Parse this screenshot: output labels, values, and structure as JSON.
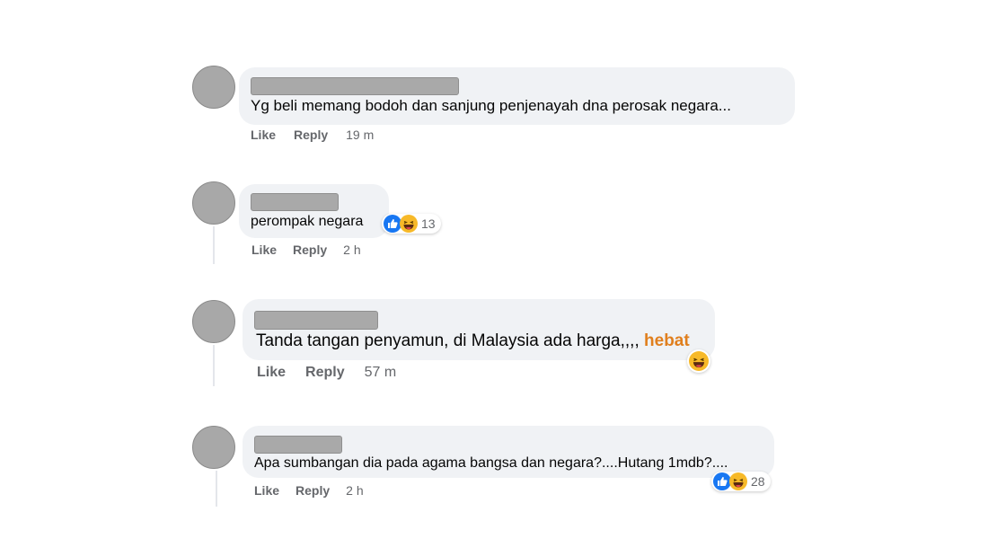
{
  "colors": {
    "bubble": "#f0f2f5",
    "muted_text": "#65676b",
    "highlight": "#e07f1e",
    "like_blue": "#1877f2",
    "haha_yellow": "#f7b928"
  },
  "comments": [
    {
      "text": "Yg beli memang bodoh dan sanjung penjenayah dna perosak negara...",
      "actions": {
        "like": "Like",
        "reply": "Reply",
        "time": "19 m"
      }
    },
    {
      "text": "perompak negara",
      "reactions": {
        "icons": [
          "like-icon",
          "haha-icon"
        ],
        "count": "13"
      },
      "actions": {
        "like": "Like",
        "reply": "Reply",
        "time": "2 h"
      }
    },
    {
      "text": "Tanda tangan penyamun, di Malaysia ada harga,,,, ",
      "highlight": "hebat",
      "reactions": {
        "icons": [
          "haha-icon"
        ]
      },
      "actions": {
        "like": "Like",
        "reply": "Reply",
        "time": "57 m"
      }
    },
    {
      "text": "Apa sumbangan dia pada agama bangsa dan negara?....Hutang 1mdb?....",
      "reactions": {
        "icons": [
          "like-icon",
          "haha-icon"
        ],
        "count": "28"
      },
      "actions": {
        "like": "Like",
        "reply": "Reply",
        "time": "2 h"
      }
    }
  ]
}
